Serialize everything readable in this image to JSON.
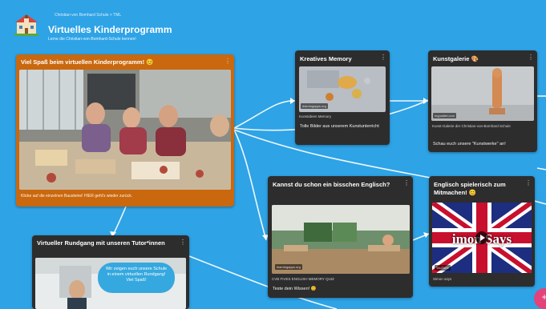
{
  "header": {
    "breadcrumb": "Christian von Bomhard Schule  >  TML",
    "title": "Virtuelles Kinderprogramm",
    "subtitle": "Lerne die Christian-von-Bomhard-Schule kennen!"
  },
  "cards": {
    "welcome": {
      "title": "Viel Spaß beim virtuellen Kinderprogramm! 😊",
      "footer": "Klicke auf die einzelnen Bausteine! HIER geht's wieder zurück."
    },
    "memory": {
      "title": "Kreatives Memory",
      "chip": "learningapps.org",
      "source": "Kunstideen Memory",
      "desc": "Tolle Bilder aus unserem Kunstunterricht"
    },
    "gallery": {
      "title": "Kunstgalerie 🎨",
      "chip": "mypadlet.com",
      "source": "Kunst-Galerie der Christian-von-Bomhard Schule",
      "desc": "Schau euch unsere \"Kunstwerke\" an!"
    },
    "english": {
      "title": "Kannst du schon ein bisschen Englisch?",
      "chip": "learningapps.org",
      "source": "CVB FIVES ENGLISH MEMORY QUIZ",
      "desc": "Teste dein Wissen! 😊"
    },
    "playful": {
      "title": "Englisch spielerisch zum Mitmachen! 😊",
      "chip": "YouTube",
      "source": "Simon says",
      "overlay": "imon Says"
    },
    "tour": {
      "title": "Virtueller Rundgang mit unseren Tutor*innen",
      "bubble": "Wir zeigen euch unsere Schule in einem virtuellen Rundgang! Viel Spaß!"
    }
  },
  "fab": {
    "label": "+"
  },
  "colors": {
    "background": "#2ea3e6",
    "card": "#2d2d2d",
    "accent_card": "#c9680e",
    "fab": "#e3427a",
    "connector": "#ffffff"
  },
  "icons": {
    "logo": "school-building-icon",
    "menu": "more-vert-icon",
    "play": "play-icon",
    "fab": "plus-icon"
  }
}
